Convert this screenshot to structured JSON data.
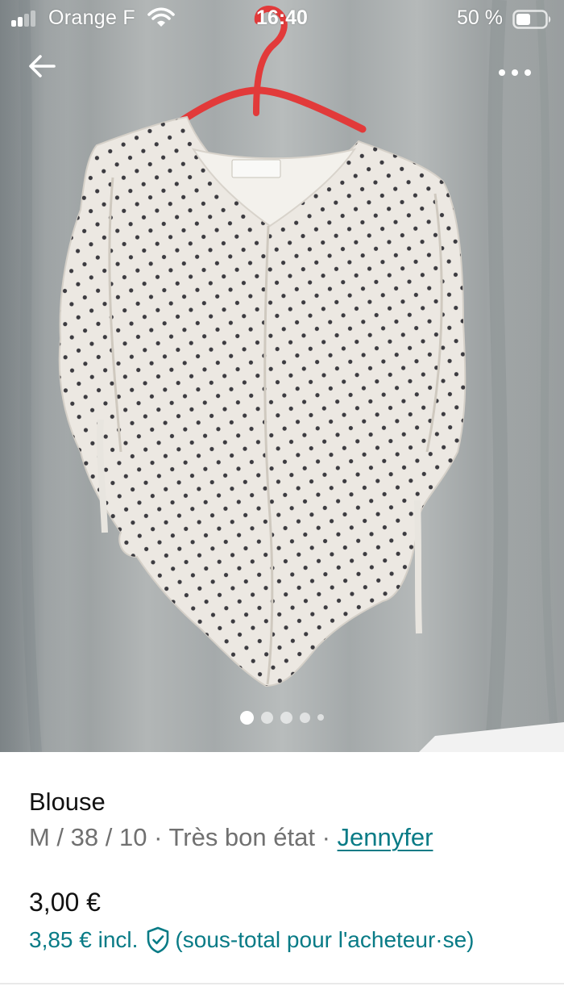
{
  "status_bar": {
    "carrier": "Orange F",
    "time": "16:40",
    "battery_percent": "50 %",
    "battery_level": 0.5,
    "signal_bars_filled": 2,
    "signal_bars_total": 4,
    "icons": [
      "signal-icon",
      "wifi-icon",
      "battery-icon"
    ]
  },
  "toolbar": {
    "back_icon": "arrow-left-icon",
    "more_icon": "more-horizontal-icon"
  },
  "gallery": {
    "photo_count": 5,
    "active_index": 0
  },
  "item": {
    "title": "Blouse",
    "size": "M / 38 / 10",
    "separator": " · ",
    "condition": "Très bon état",
    "brand": "Jennyfer",
    "price": "3,00 €",
    "price_total": "3,85 € incl.",
    "price_total_note": "(sous-total pour l'acheteur·se)",
    "protection_icon": "shield-check-icon"
  },
  "colors": {
    "accent": "#087b86",
    "text_primary": "#111111",
    "text_secondary": "#707070"
  }
}
